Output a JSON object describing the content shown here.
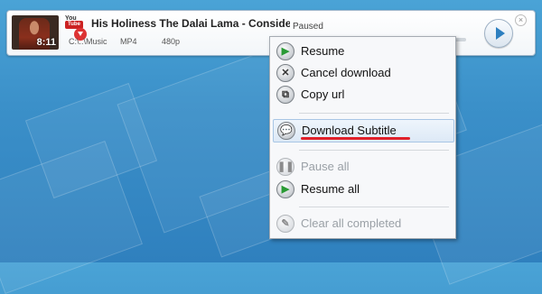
{
  "item": {
    "title": "His Holiness The Dalai Lama - Consider F...",
    "duration": "8:11",
    "status": "Paused",
    "path": "C:\\..\\Music",
    "format": "MP4",
    "resolution": "480p",
    "progress_fraction": 0.0,
    "logo_line1": "You",
    "logo_line2": "Tube"
  },
  "menu": {
    "items": [
      {
        "label": "Resume",
        "icon": "resume-icon",
        "enabled": true
      },
      {
        "label": "Cancel download",
        "icon": "cancel-icon",
        "enabled": true
      },
      {
        "label": "Copy url",
        "icon": "copy-icon",
        "enabled": true
      },
      {
        "label": "Download Subtitle",
        "icon": "subtitle-icon",
        "enabled": true,
        "highlighted": true
      },
      {
        "label": "Pause all",
        "icon": "pause-icon",
        "enabled": false
      },
      {
        "label": "Resume all",
        "icon": "resume-icon",
        "enabled": true
      },
      {
        "label": "Clear all completed",
        "icon": "broom-icon",
        "enabled": false
      }
    ]
  },
  "colors": {
    "accent": "#2d7fc0",
    "highlight_underline": "#e0202a",
    "background": "#3b90c9"
  }
}
